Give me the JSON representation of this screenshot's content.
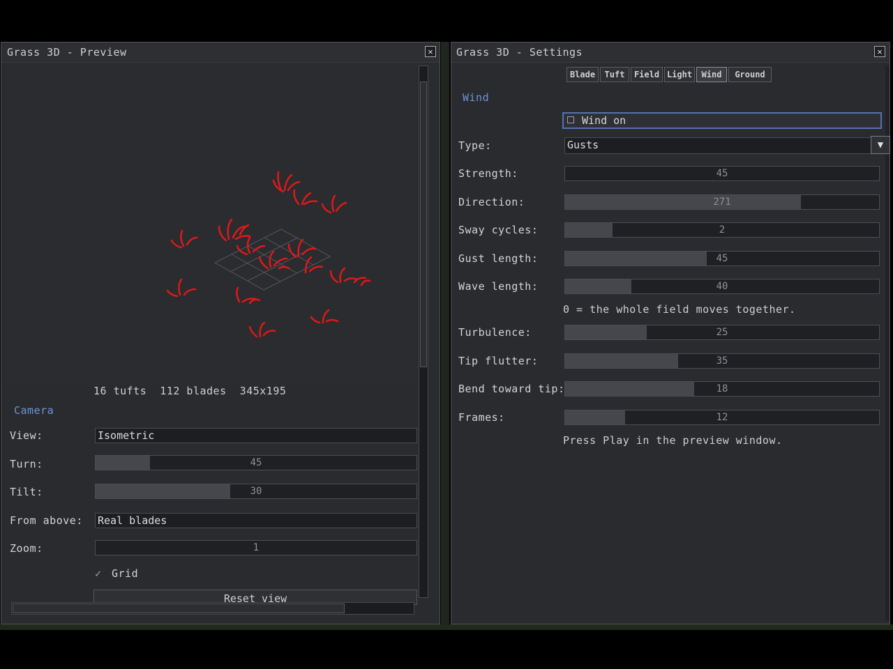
{
  "preview_window": {
    "title": "Grass 3D - Preview",
    "close_glyph": "✕",
    "stats": "16 tufts  112 blades  345x195",
    "camera_section": "Camera",
    "view_label": "View:",
    "view_value": "Isometric",
    "turn_label": "Turn:",
    "turn_value": "45",
    "turn_fraction": 0.17,
    "tilt_label": "Tilt:",
    "tilt_value": "30",
    "tilt_fraction": 0.42,
    "from_above_label": "From above:",
    "from_above_value": "Real blades",
    "zoom_label": "Zoom:",
    "zoom_value": "1",
    "zoom_fraction": 0.0,
    "grid_label": "Grid",
    "grid_checked": true,
    "reset_label": "Reset view"
  },
  "settings_window": {
    "title": "Grass 3D - Settings",
    "close_glyph": "✕",
    "tabs": [
      "Blade",
      "Tuft",
      "Field",
      "Light",
      "Wind",
      "Ground"
    ],
    "active_tab": "Wind",
    "section": "Wind",
    "wind_on_label": "Wind on",
    "wind_on_checked": false,
    "type_label": "Type:",
    "type_value": "Gusts",
    "sliders": [
      {
        "label": "Strength:",
        "value": "45",
        "fraction": 0.0
      },
      {
        "label": "Direction:",
        "value": "271",
        "fraction": 0.75
      },
      {
        "label": "Sway cycles:",
        "value": "2",
        "fraction": 0.15
      },
      {
        "label": "Gust length:",
        "value": "45",
        "fraction": 0.45
      },
      {
        "label": "Wave length:",
        "value": "40",
        "fraction": 0.21
      }
    ],
    "wave_note": "0 = the whole field moves together.",
    "sliders2": [
      {
        "label": "Turbulence:",
        "value": "25",
        "fraction": 0.26
      },
      {
        "label": "Tip flutter:",
        "value": "35",
        "fraction": 0.36
      },
      {
        "label": "Bend toward tip:",
        "value": "18",
        "fraction": 0.41
      },
      {
        "label": "Frames:",
        "value": "12",
        "fraction": 0.19
      }
    ],
    "play_note": "Press Play in the preview window."
  },
  "colors": {
    "accent": "#6f93d6",
    "grass": "#e01818"
  }
}
